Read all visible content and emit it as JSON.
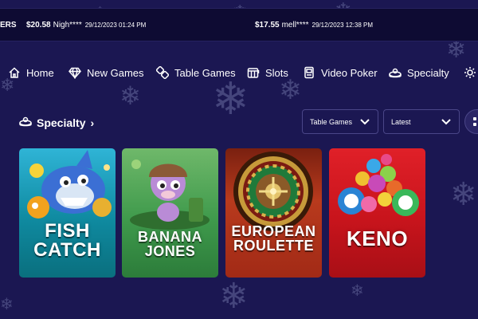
{
  "ticker": {
    "fragment": "ERS",
    "items": [
      {
        "amount": "$20.58",
        "user": "Nigh****",
        "date": "29/12/2023 01:24 PM"
      },
      {
        "amount": "$17.55",
        "user": "mell****",
        "date": "29/12/2023 12:38 PM"
      }
    ]
  },
  "nav": {
    "items": [
      {
        "label": "Home",
        "icon": "house-icon"
      },
      {
        "label": "New Games",
        "icon": "diamond-icon"
      },
      {
        "label": "Table Games",
        "icon": "dice-icon"
      },
      {
        "label": "Slots",
        "icon": "slot-machine-icon"
      },
      {
        "label": "Video Poker",
        "icon": "poker-machine-icon"
      },
      {
        "label": "Specialty",
        "icon": "bingo-icon"
      }
    ]
  },
  "section": {
    "title": "Specialty",
    "icon": "bingo-icon",
    "filter": {
      "selected": "Table Games"
    },
    "sort": {
      "selected": "Latest"
    }
  },
  "games": [
    {
      "title": "FISH\nCATCH"
    },
    {
      "title": "BANANA\nJONES"
    },
    {
      "title": "EUROPEAN\nROULETTE"
    },
    {
      "title": "KENO"
    }
  ],
  "colors": {
    "background": "#1b1752",
    "ticker_background": "#0e0b33",
    "fish_card": "#0f8aa0",
    "banana_card": "#3f9a4c",
    "roulette_card": "#b83a1d",
    "keno_card": "#c8141c"
  }
}
